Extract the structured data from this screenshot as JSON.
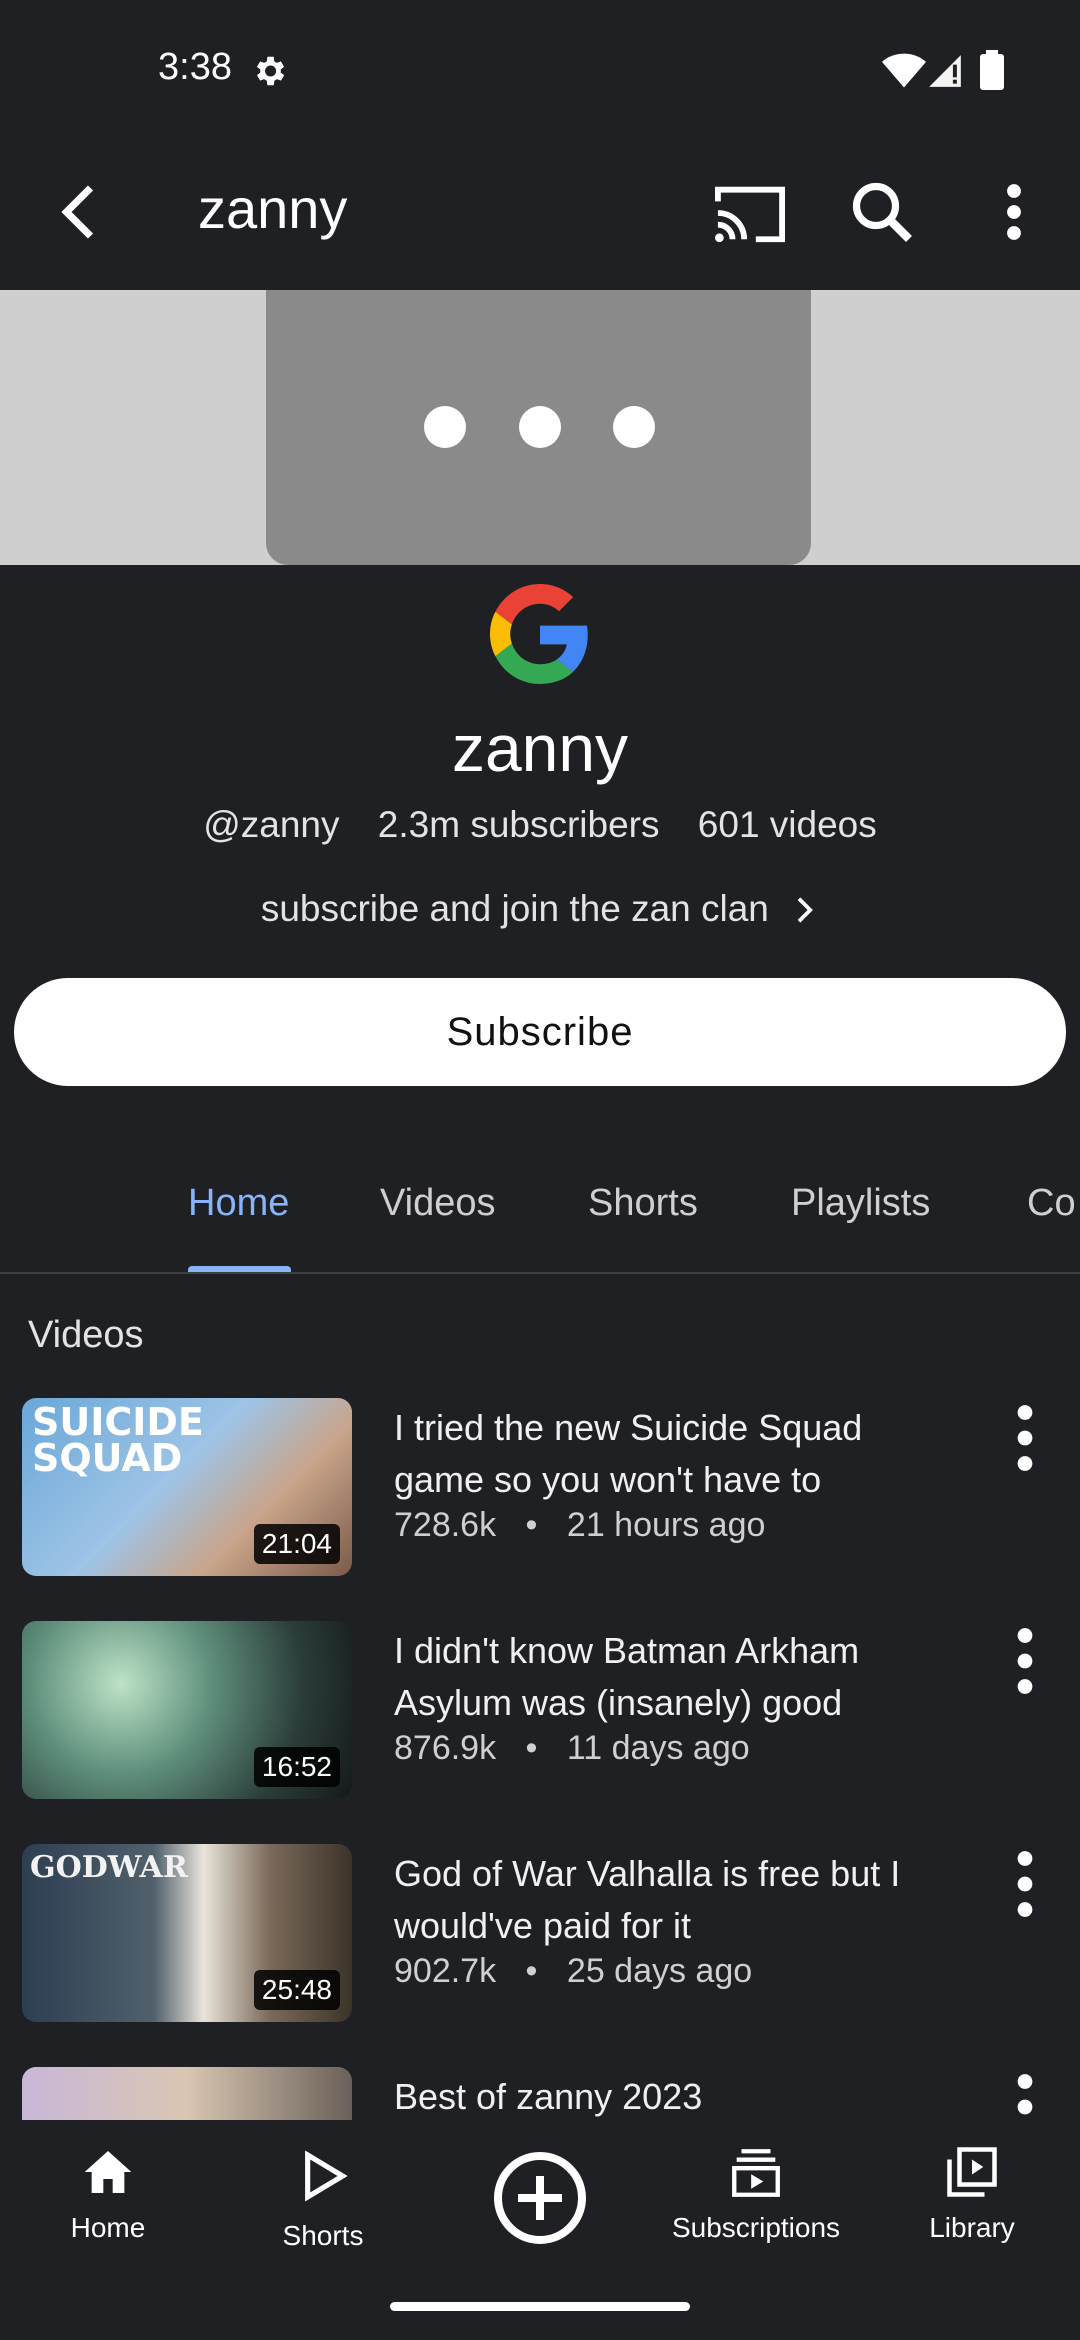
{
  "status_bar": {
    "time": "3:38"
  },
  "app_bar": {
    "title": "zanny"
  },
  "channel": {
    "name": "zanny",
    "handle": "@zanny",
    "subscribers": "2.3m subscribers",
    "videos_count": "601 videos",
    "description": "subscribe and join the zan clan",
    "subscribe_label": "Subscribe"
  },
  "tabs": [
    {
      "label": "Home",
      "selected": true
    },
    {
      "label": "Videos"
    },
    {
      "label": "Shorts"
    },
    {
      "label": "Playlists"
    },
    {
      "label": "Co"
    }
  ],
  "section": {
    "title": "Videos"
  },
  "videos": [
    {
      "title": "I tried the new Suicide Squad game so you won't have to",
      "views": "728.6k",
      "age": "21 hours ago",
      "duration": "21:04"
    },
    {
      "title": "I didn't know Batman Arkham Asylum was (insanely) good",
      "views": "876.9k",
      "age": "11 days ago",
      "duration": "16:52"
    },
    {
      "title": "God of War Valhalla is free but I would've paid for it",
      "views": "902.7k",
      "age": "25 days ago",
      "duration": "25:48"
    },
    {
      "title": "Best of zanny 2023"
    }
  ],
  "separator": "•",
  "bottom_nav": {
    "home": "Home",
    "shorts": "Shorts",
    "subscriptions": "Subscriptions",
    "library": "Library"
  },
  "colors": {
    "accent": "#8ab4f8",
    "background": "#1f2023"
  }
}
